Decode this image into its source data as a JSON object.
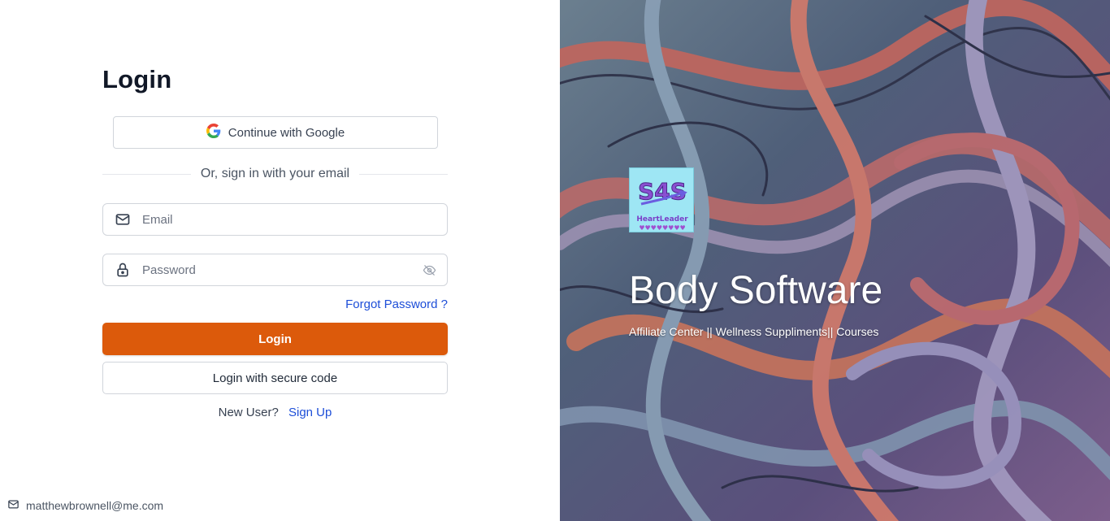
{
  "login": {
    "title": "Login",
    "google_button": "Continue with Google",
    "divider_text": "Or, sign in with your email",
    "email_placeholder": "Email",
    "password_placeholder": "Password",
    "forgot_password": "Forgot Password ?",
    "login_button": "Login",
    "secure_code_button": "Login with secure code",
    "new_user_text": "New User?",
    "sign_up_link": "Sign Up"
  },
  "footer": {
    "email": "matthewbrownell@me.com"
  },
  "brand": {
    "name": "Body Software",
    "tagline": "Affiliate Center || Wellness Suppliments|| Courses",
    "logo_text": "S4S",
    "logo_caption": "HeartLeader"
  },
  "icons": {
    "google": "google-icon",
    "email": "mail-icon",
    "password": "lock-icon",
    "visibility": "eye-off-icon",
    "footer": "mail-icon"
  },
  "colors": {
    "accent": "#dc5a0b",
    "link": "#1d4ed8",
    "logo_bg": "#9ee6f4"
  }
}
